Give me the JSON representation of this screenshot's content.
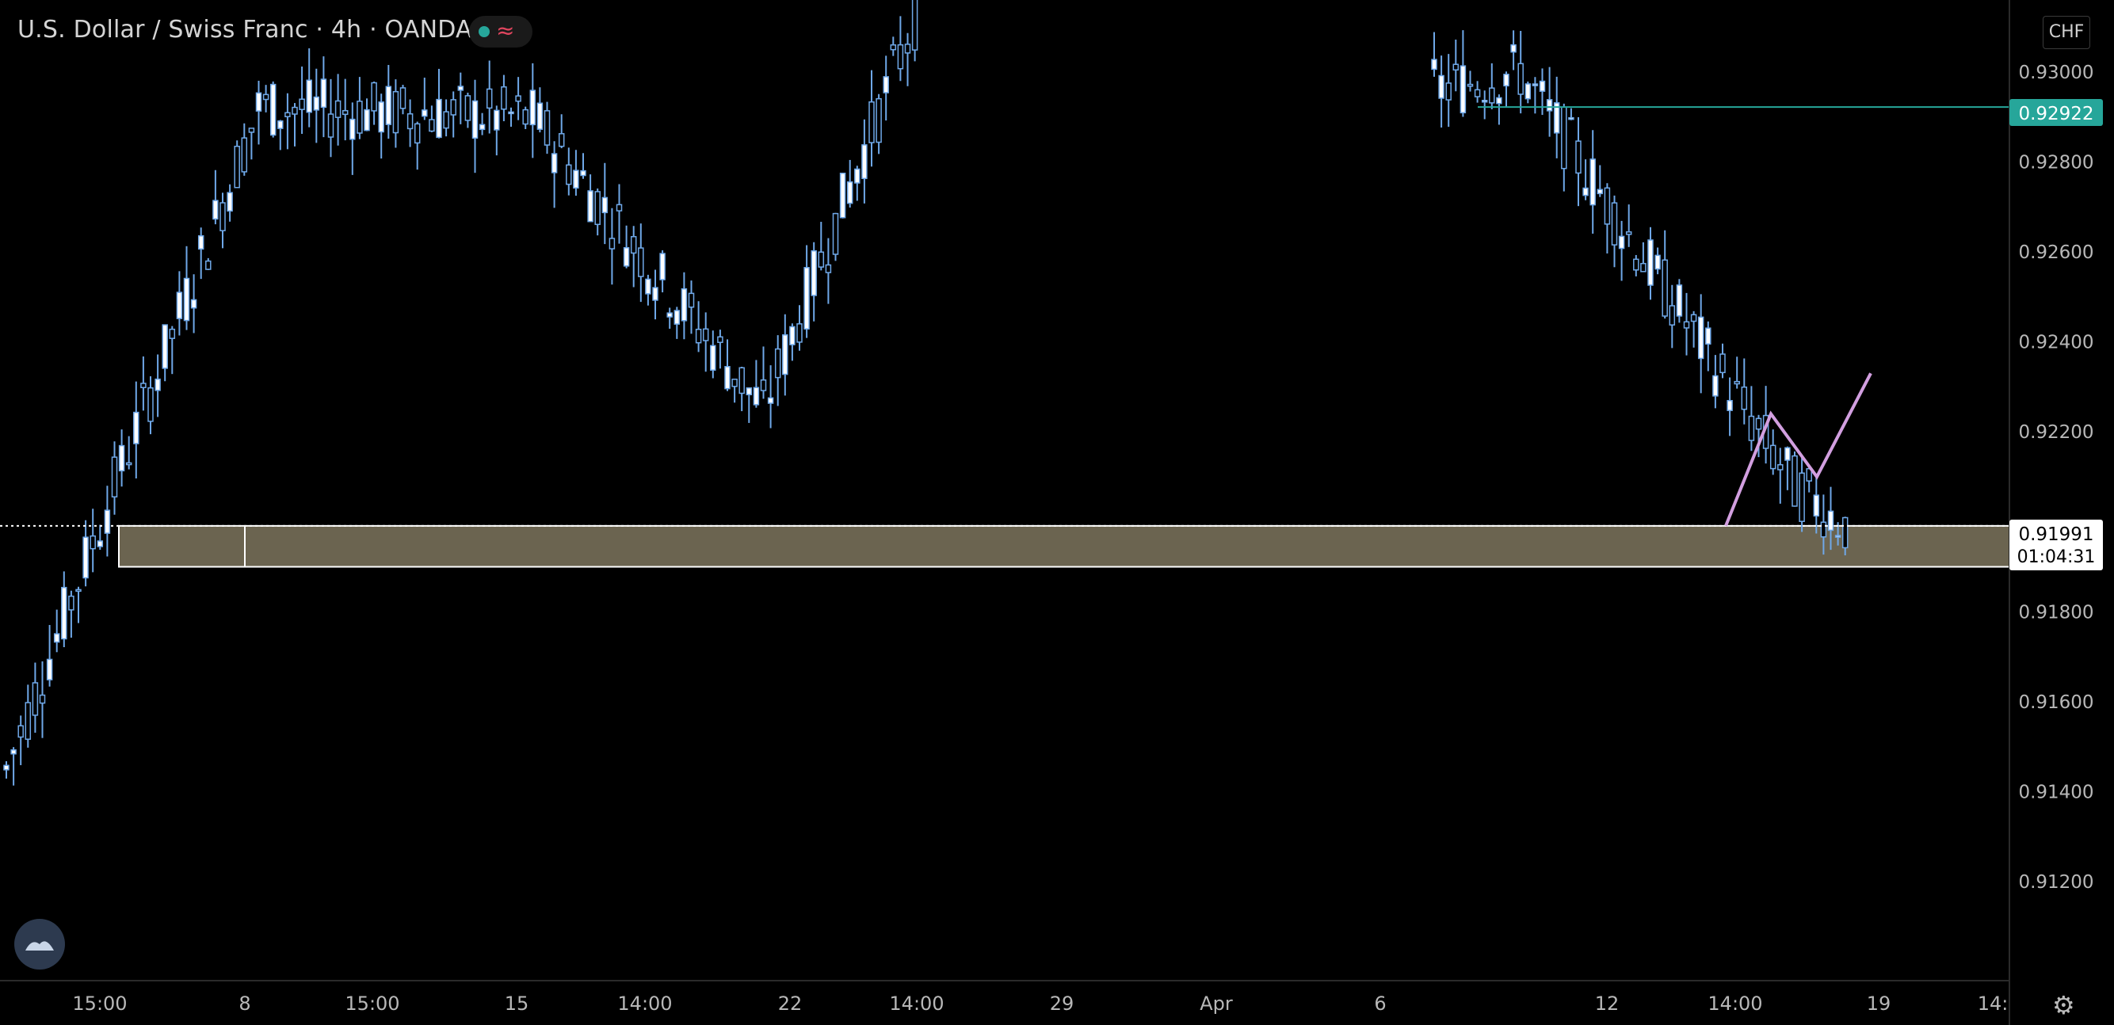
{
  "header": {
    "title": "U.S. Dollar / Swiss Franc · 4h · OANDA",
    "currency_label": "CHF"
  },
  "icons": {
    "status": "market-status-icon",
    "logo": "tradingview-logo-icon",
    "settings": "gear-icon"
  },
  "colors": {
    "background": "#000000",
    "candle_body": "#ffffff",
    "candle_outline": "#6fa8e8",
    "zone_fill": "#6b6450",
    "zone_border": "#ffffff",
    "projection": "#d29fe0",
    "marker_line": "#26a69a",
    "status_dot": "#26a69a"
  },
  "chart_data": {
    "type": "candlestick",
    "y_axis": {
      "range": [
        0.9098,
        0.9316
      ],
      "tick_labels": [
        "0.93000",
        "0.92800",
        "0.92600",
        "0.92400",
        "0.92200",
        "0.91991",
        "0.91800",
        "0.91600",
        "0.91400",
        "0.91200"
      ],
      "ticks": [
        0.93,
        0.928,
        0.926,
        0.924,
        0.922,
        0.918,
        0.916,
        0.914,
        0.912
      ]
    },
    "x_axis": {
      "tick_labels": [
        "15:00",
        "8",
        "15:00",
        "15",
        "14:00",
        "22",
        "14:00",
        "29",
        "Apr",
        "6",
        "12",
        "14:00",
        "19",
        "14:"
      ]
    },
    "current_price": {
      "value": 0.91991,
      "label": "0.91991",
      "countdown": "01:04:31"
    },
    "marker_price": {
      "value": 0.92922,
      "label": "0.92922"
    },
    "support_zone": {
      "top": 0.91991,
      "bottom": 0.919
    },
    "projection_path": [
      0.91991,
      0.9224,
      0.921,
      0.9233
    ],
    "segments": [
      {
        "from": 0.9145,
        "to": 0.9292,
        "n": 35
      },
      {
        "from": 0.9292,
        "to": 0.929,
        "n": 38
      },
      {
        "from": 0.929,
        "to": 0.9225,
        "n": 32
      },
      {
        "from": 0.9225,
        "to": 0.9316,
        "n": 22
      },
      {
        "from": 0.9296,
        "to": 0.93,
        "n": 12
      },
      {
        "from": 0.93,
        "to": 0.9208,
        "n": 38
      },
      {
        "from": 0.9208,
        "to": 0.9198,
        "n": 8
      }
    ]
  }
}
